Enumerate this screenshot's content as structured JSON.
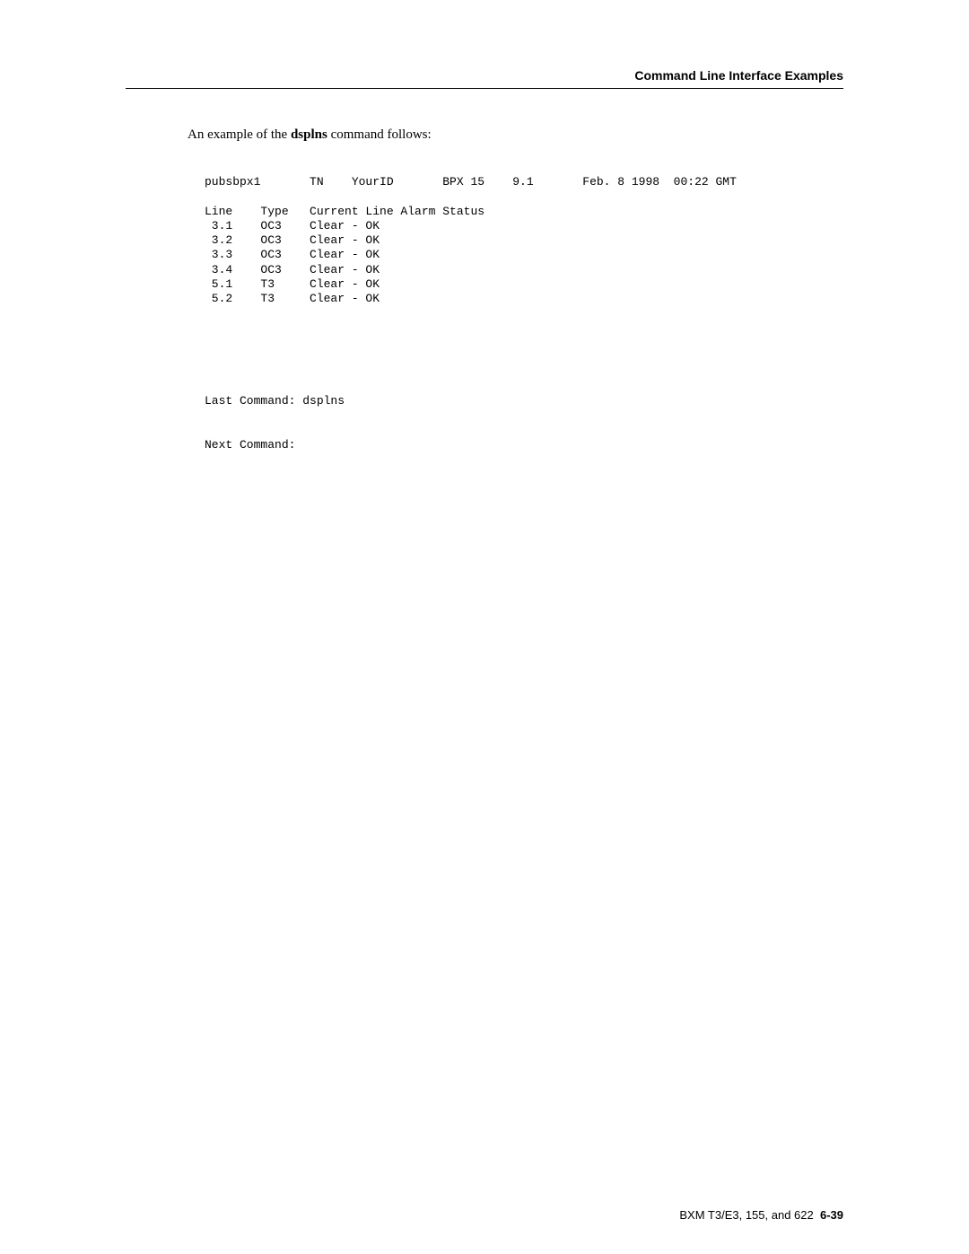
{
  "header": {
    "title": "Command Line Interface Examples"
  },
  "intro": {
    "prefix": "An example of the ",
    "command": "dsplns",
    "suffix": " command follows:"
  },
  "terminal": {
    "line1": "pubsbpx1       TN    YourID       BPX 15    9.1       Feb. 8 1998  00:22 GMT",
    "blank1": "",
    "header_row": "Line    Type   Current Line Alarm Status",
    "row1": " 3.1    OC3    Clear - OK",
    "row2": " 3.2    OC3    Clear - OK",
    "row3": " 3.3    OC3    Clear - OK",
    "row4": " 3.4    OC3    Clear - OK",
    "row5": " 5.1    T3     Clear - OK",
    "row6": " 5.2    T3     Clear - OK",
    "last_cmd": "Last Command: dsplns",
    "next_cmd": "Next Command:"
  },
  "footer": {
    "chapter": "BXM T3/E3, 155, and 622",
    "page": "6-39"
  }
}
